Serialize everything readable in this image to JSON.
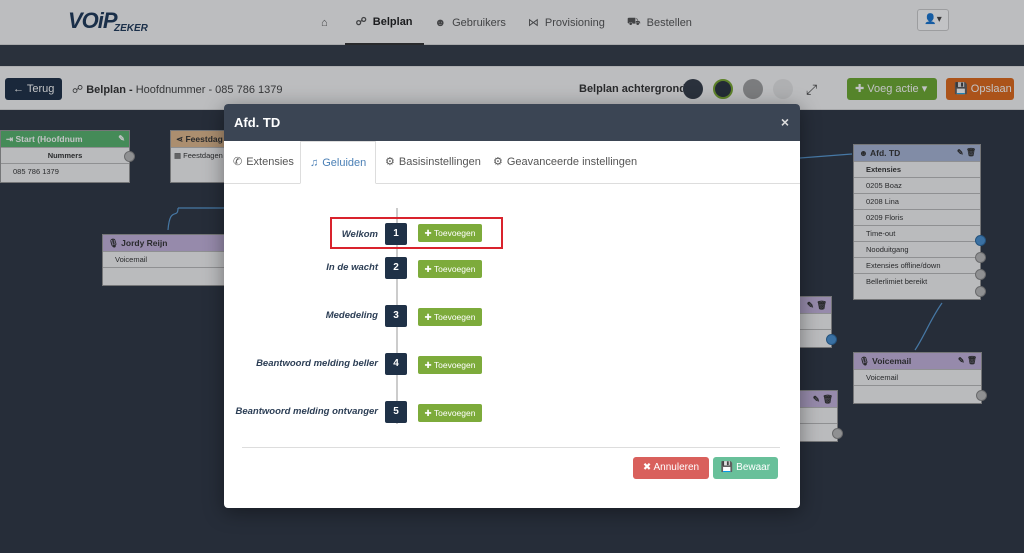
{
  "app": {
    "logo_main": "VOiP",
    "logo_sub": "ZEKER"
  },
  "nav": {
    "items": [
      {
        "label": "",
        "icon": "home-icon"
      },
      {
        "label": "Belplan",
        "icon": "sitemap-icon",
        "active": true
      },
      {
        "label": "Gebruikers",
        "icon": "users-icon"
      },
      {
        "label": "Provisioning",
        "icon": "network-icon"
      },
      {
        "label": "Bestellen",
        "icon": "cart-icon"
      }
    ],
    "user_icon": "user-icon"
  },
  "toolbar": {
    "back_label": "Terug",
    "title_bold": "Belplan -",
    "title_rest": " Hoofdnummer - 085 786 1379",
    "background_label": "Belplan achtergrond",
    "background_colors": [
      "#343c48",
      "#2b3440",
      "#a0a0a0",
      "#e6e6e6"
    ],
    "add_action_label": "Voeg actie",
    "save_label": "Opslaan"
  },
  "canvas": {
    "nodes": {
      "start": {
        "title": "Start (Hoofdnum",
        "header_color": "#58b56e",
        "rows": [
          "Nummers",
          "085 786 1379"
        ]
      },
      "feest": {
        "title": "Feestdag",
        "header_color": "#e0b98c",
        "rows": [
          "Feestdagen"
        ]
      },
      "jordy": {
        "title": "Jordy Reijn",
        "header_color": "#c4b3dc",
        "rows": [
          "Voicemail",
          ""
        ]
      },
      "afd": {
        "title": "Afd. TD",
        "header_color": "#a9b6d6",
        "rows": [
          "Extensies",
          "0205 Boaz",
          "0208 Lina",
          "0209 Floris",
          "Time-out",
          "Nooduitgang",
          "Extensies offline/down",
          "Bellerlimiet bereikt"
        ]
      },
      "voicemail": {
        "title": "Voicemail",
        "header_color": "#c4b3dc",
        "rows": [
          "Voicemail",
          ""
        ]
      }
    }
  },
  "modal": {
    "title": "Afd. TD",
    "close": "×",
    "tabs": [
      {
        "label": "Extensies",
        "icon": "phone-icon"
      },
      {
        "label": "Geluiden",
        "icon": "music-icon",
        "active": true
      },
      {
        "label": "Basisinstellingen",
        "icon": "gear-icon"
      },
      {
        "label": "Geavanceerde instellingen",
        "icon": "gear-icon"
      }
    ],
    "steps": [
      {
        "label": "Welkom",
        "num": "1",
        "button": "Toevoegen"
      },
      {
        "label": "In de wacht",
        "num": "2",
        "button": "Toevoegen"
      },
      {
        "label": "Mededeling",
        "num": "3",
        "button": "Toevoegen"
      },
      {
        "label": "Beantwoord melding beller",
        "num": "4",
        "button": "Toevoegen"
      },
      {
        "label": "Beantwoord melding ontvanger",
        "num": "5",
        "button": "Toevoegen"
      }
    ],
    "cancel_label": "Annuleren",
    "save_label": "Bewaar"
  }
}
